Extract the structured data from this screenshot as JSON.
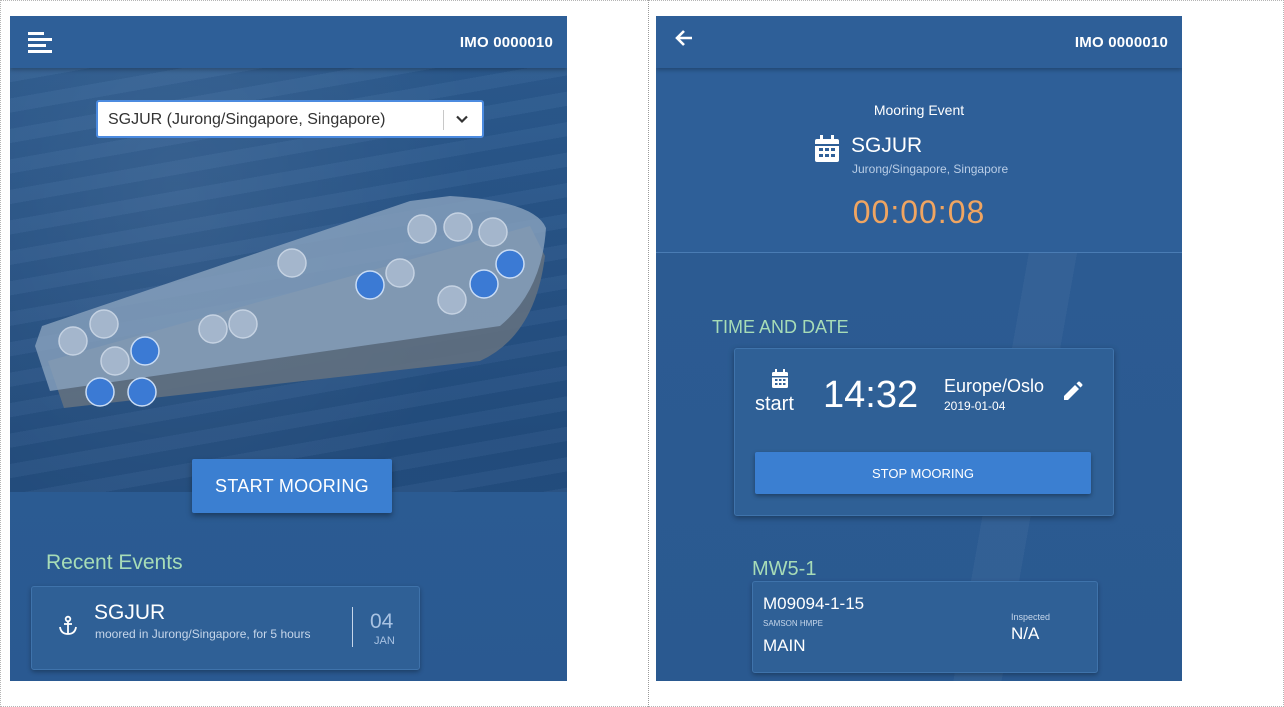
{
  "left_screen": {
    "appbar": {
      "imo": "IMO 0000010",
      "menu_icon": "menu-icon"
    },
    "port_select": {
      "value": "SGJUR (Jurong/Singapore, Singapore)",
      "icon": "chevron-down-icon"
    },
    "ship": {
      "bollards": [
        {
          "id": "b1",
          "active": false
        },
        {
          "id": "b2",
          "active": false
        },
        {
          "id": "b3",
          "active": false
        },
        {
          "id": "b4",
          "active": true
        },
        {
          "id": "b5",
          "active": true
        },
        {
          "id": "b6",
          "active": true
        },
        {
          "id": "b7",
          "active": false
        },
        {
          "id": "b8",
          "active": false
        },
        {
          "id": "b9",
          "active": false
        },
        {
          "id": "b10",
          "active": true
        },
        {
          "id": "b11",
          "active": false
        },
        {
          "id": "b12",
          "active": false
        },
        {
          "id": "b13",
          "active": true
        },
        {
          "id": "b14",
          "active": true
        },
        {
          "id": "b15",
          "active": false
        },
        {
          "id": "b16",
          "active": false
        },
        {
          "id": "b17",
          "active": false
        }
      ]
    },
    "start_button": "START MOORING",
    "recent_events": {
      "title": "Recent Events",
      "items": [
        {
          "port": "SGJUR",
          "description": "moored in Jurong/Singapore, for 5 hours",
          "day": "04",
          "month": "JAN",
          "icon": "anchor-icon"
        }
      ]
    }
  },
  "right_screen": {
    "appbar": {
      "imo": "IMO 0000010",
      "back_icon": "arrow-left-icon"
    },
    "mooring_event": {
      "title": "Mooring Event",
      "port": "SGJUR",
      "location": "Jurong/Singapore, Singapore",
      "timer": "00:00:08",
      "icon": "calendar-icon"
    },
    "time_and_date": {
      "title": "TIME AND DATE",
      "label": "start",
      "time": "14:32",
      "timezone": "Europe/Oslo",
      "date": "2019-01-04",
      "edit_icon": "pencil-icon",
      "stop_button": "STOP MOORING"
    },
    "line_group": {
      "title": "MW5-1",
      "line": {
        "id": "M09094-1-15",
        "maker": "SAMSON HMPE",
        "type": "MAIN",
        "inspected_label": "Inspected",
        "inspected_value": "N/A"
      }
    }
  },
  "colors": {
    "appbar": "#2e5f98",
    "accent_button": "#3b7fd1",
    "section_title": "#a7dcb7",
    "timer": "#f0a561",
    "bollard_active": "#3b7ad4"
  }
}
